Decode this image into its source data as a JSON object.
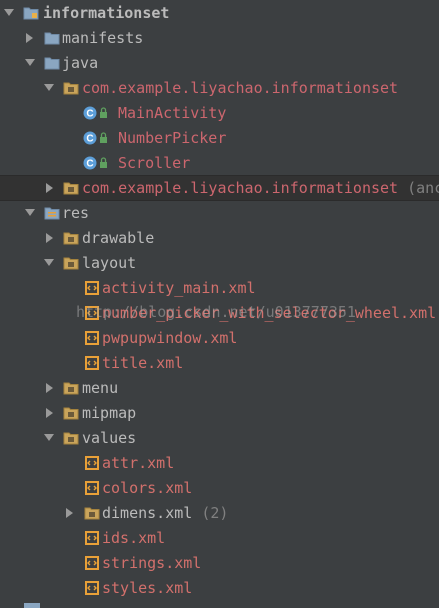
{
  "tree": {
    "root": "informationset",
    "manifests": "manifests",
    "java": "java",
    "package_main": "com.example.liyachao.informationset",
    "class_main_activity": "MainActivity",
    "class_number_picker": "NumberPicker",
    "class_scroller": "Scroller",
    "package_test": "com.example.liyachao.informationset",
    "package_test_suffix": "(anc",
    "res": "res",
    "drawable": "drawable",
    "layout": "layout",
    "layout_activity_main": "activity_main.xml",
    "layout_number_picker": "number_picker_with_selector_wheel.xml",
    "layout_pwpupwindow": "pwpupwindow.xml",
    "layout_title": "title.xml",
    "menu": "menu",
    "mipmap": "mipmap",
    "values": "values",
    "values_attr": "attr.xml",
    "values_colors": "colors.xml",
    "values_dimens": "dimens.xml",
    "values_dimens_count": "(2)",
    "values_ids": "ids.xml",
    "values_strings": "strings.xml",
    "values_styles": "styles.xml"
  },
  "watermark": "http://blog.csdn.net/u013777351"
}
